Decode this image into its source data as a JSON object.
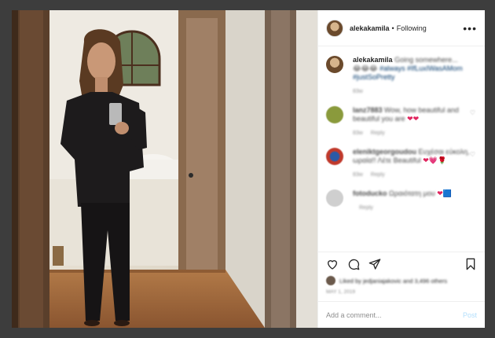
{
  "header": {
    "username": "alekakamila",
    "separator": "•",
    "follow_status": "Following",
    "more_label": "•••"
  },
  "caption": {
    "username": "alekakamila",
    "text": "Going somewhere...",
    "emojis": "😂😂😂",
    "hashtags": "#always #IfLuxIWasAMom #justSoPretty",
    "time": "83w"
  },
  "comments": [
    {
      "username": "lanz7883",
      "text": "Wow, how beautiful and beautiful you are",
      "hearts": "❤❤",
      "time": "83w",
      "action": "Reply",
      "avatar_color": "#8a9a3c"
    },
    {
      "username": "eleniktgeorgoudou",
      "text": "Ευχέσαι εύκολη, ωραία!! Λέτε Beautiful",
      "hearts": "❤💗🌹",
      "time": "83w",
      "action": "Reply",
      "avatar_color": "#c0392b"
    },
    {
      "username": "fotoducko",
      "text": "Ωραιότατη μου",
      "hearts": "❤🟦",
      "time": "",
      "action": "Reply",
      "avatar_color": "#9a9a9a"
    }
  ],
  "likes": {
    "text": "Liked by jedjaniajakovic and 3,496 others"
  },
  "date": "MAY 1, 2019",
  "add_comment": {
    "placeholder": "Add a comment...",
    "post_label": "Post"
  }
}
